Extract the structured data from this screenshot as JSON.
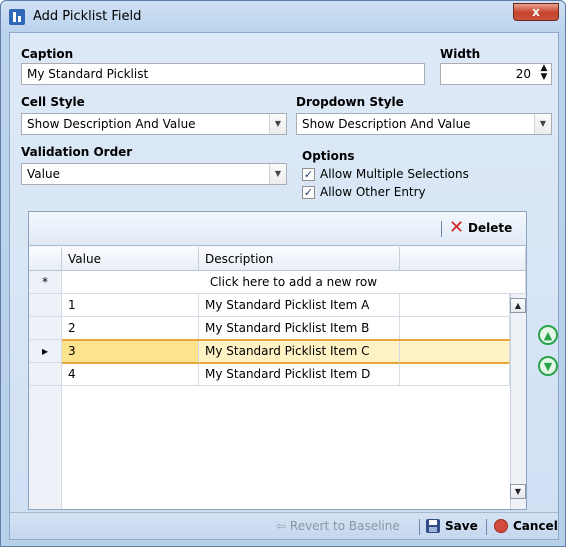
{
  "window": {
    "title": "Add Picklist Field",
    "close_label": "x"
  },
  "caption": {
    "label": "Caption",
    "value": "My Standard Picklist"
  },
  "width": {
    "label": "Width",
    "value": "20"
  },
  "cell_style": {
    "label": "Cell Style",
    "value": "Show Description And Value"
  },
  "dropdown_style": {
    "label": "Dropdown Style",
    "value": "Show Description And Value"
  },
  "validation_order": {
    "label": "Validation Order",
    "value": "Value"
  },
  "options": {
    "label": "Options",
    "items": [
      {
        "label": "Allow Multiple Selections",
        "checked": true
      },
      {
        "label": "Allow Other Entry",
        "checked": true
      }
    ]
  },
  "grid": {
    "delete_label": "Delete",
    "columns": [
      "Value",
      "Description"
    ],
    "new_row_text": "Click here to add a new row",
    "new_row_marker": "*",
    "selected_marker": "▸",
    "rows": [
      {
        "value": "1",
        "description": "My Standard Picklist Item A"
      },
      {
        "value": "2",
        "description": "My Standard Picklist Item B"
      },
      {
        "value": "3",
        "description": "My Standard Picklist Item C"
      },
      {
        "value": "4",
        "description": "My Standard Picklist Item D"
      }
    ]
  },
  "footer": {
    "revert_label": "Revert to Baseline",
    "save_label": "Save",
    "cancel_label": "Cancel"
  },
  "colors": {
    "selected_row": "#fde38d",
    "accent_green": "#2aa44a",
    "delete_red": "#d2261e"
  }
}
